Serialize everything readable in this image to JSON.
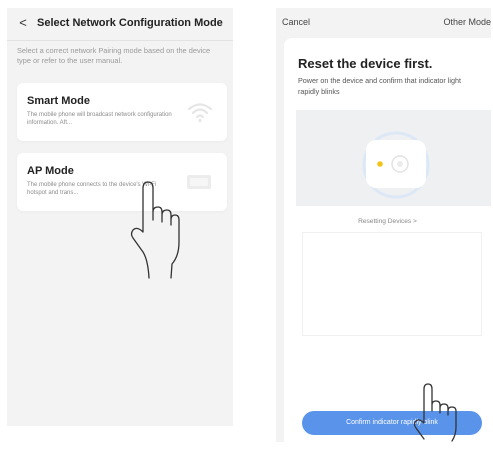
{
  "left_screen": {
    "back_glyph": "<",
    "title": "Select Network Configuration Mode",
    "description": "Select a correct network Pairing mode based on the device type or refer to the user manual.",
    "cards": [
      {
        "title": "Smart Mode",
        "description": "The mobile phone will broadcast network configuration information. Aft...",
        "icon": "wifi-icon"
      },
      {
        "title": "AP Mode",
        "description": "The mobile phone connects to the device's Wi-Fi hotspot and trans...",
        "icon": "device-icon"
      }
    ]
  },
  "right_screen": {
    "cancel_label": "Cancel",
    "other_mode_label": "Other Mode",
    "title": "Reset the device first.",
    "description": "Power on the device and confirm that indicator light rapidly blinks",
    "reset_link": "Resetting Devices >",
    "confirm_button": "Confirm indicator rapidly blink"
  },
  "colors": {
    "accent_button": "#5a93ea",
    "indicator_light": "#f3c319",
    "screen_bg": "#f3f3f3"
  }
}
